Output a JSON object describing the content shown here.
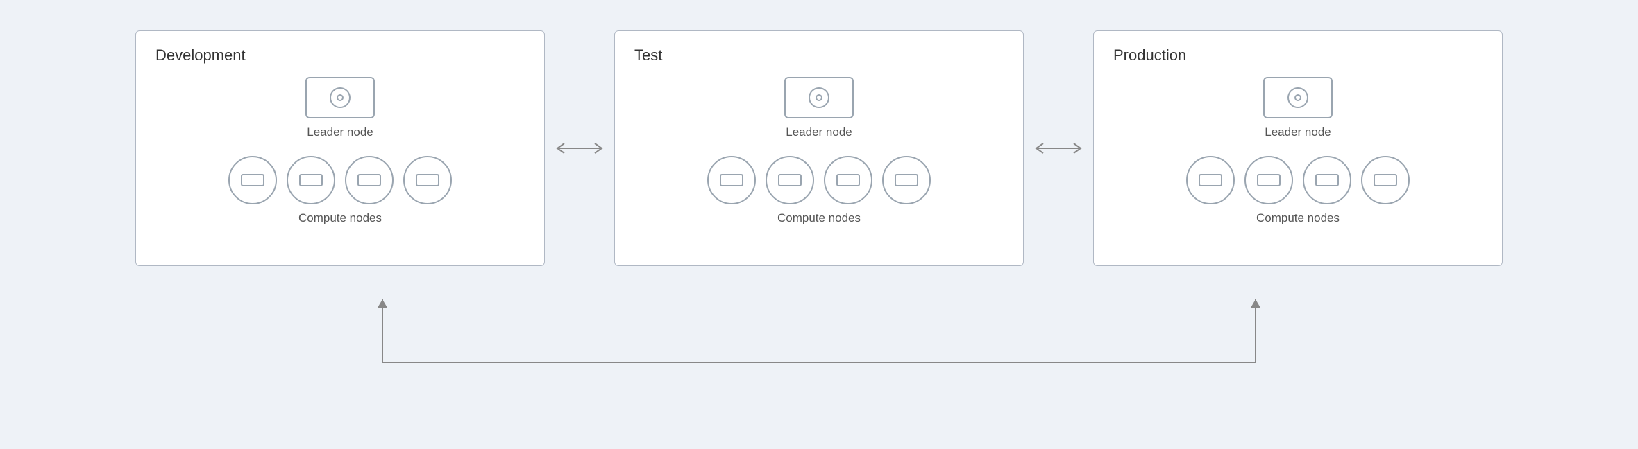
{
  "environments": [
    {
      "id": "development",
      "title": "Development",
      "leader_label": "Leader node",
      "compute_label": "Compute nodes",
      "compute_count": 4
    },
    {
      "id": "test",
      "title": "Test",
      "leader_label": "Leader node",
      "compute_label": "Compute nodes",
      "compute_count": 4
    },
    {
      "id": "production",
      "title": "Production",
      "leader_label": "Leader node",
      "compute_label": "Compute nodes",
      "compute_count": 4
    }
  ],
  "arrows": {
    "horizontal": "↔",
    "bottom_connector_visible": true
  }
}
